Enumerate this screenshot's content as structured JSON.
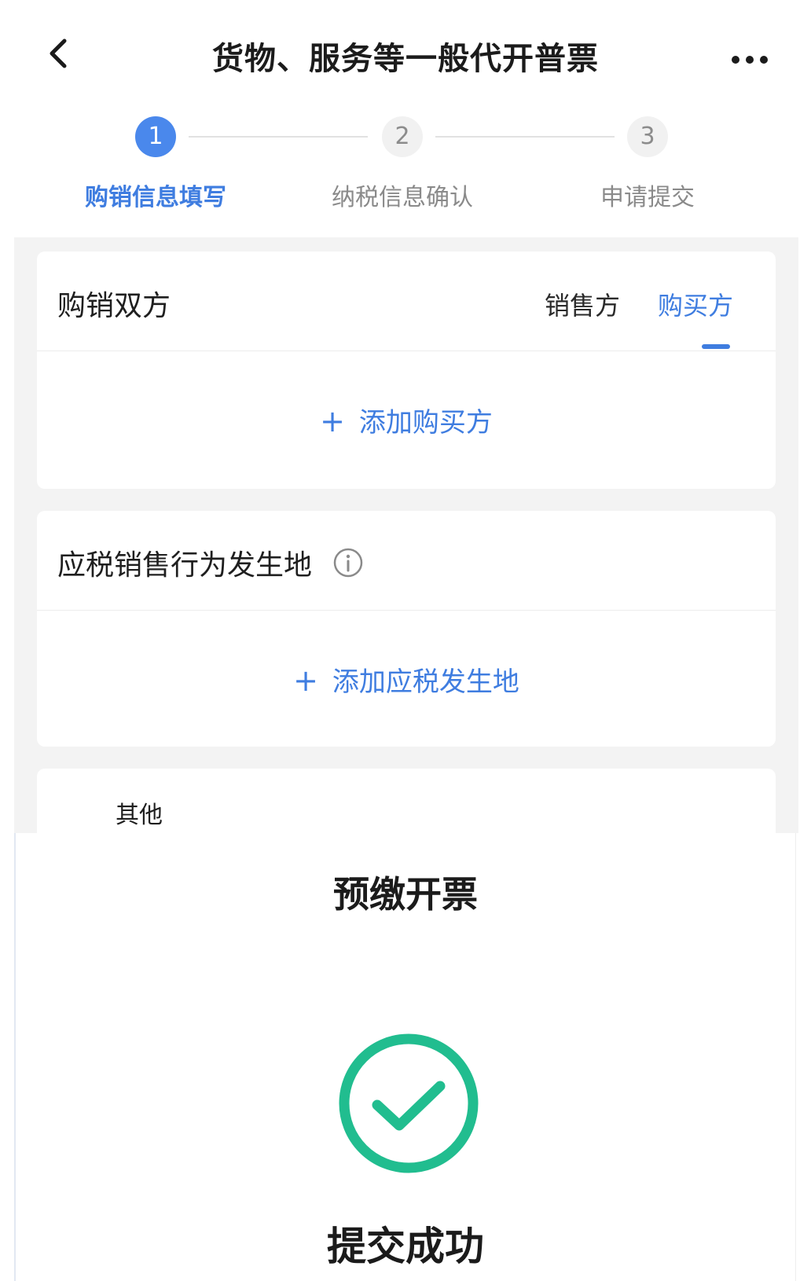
{
  "nav": {
    "back_icon": "chevron-left-icon",
    "title": "货物、服务等一般代开普票",
    "more_icon": "more-horizontal-icon"
  },
  "steps": [
    {
      "number": "1",
      "label": "购销信息填写",
      "state": "active"
    },
    {
      "number": "2",
      "label": "纳税信息确认",
      "state": "inactive"
    },
    {
      "number": "3",
      "label": "申请提交",
      "state": "inactive"
    }
  ],
  "parties_card": {
    "title": "购销双方",
    "tabs": [
      {
        "label": "销售方",
        "selected": false
      },
      {
        "label": "购买方",
        "selected": true
      }
    ],
    "add_label": "添加购买方"
  },
  "location_card": {
    "title": "应税销售行为发生地",
    "info_icon": "info-circle-icon",
    "add_label": "添加应税发生地"
  },
  "next_card": {
    "partial_title": "其他"
  },
  "prepay": {
    "title": "预缴开票",
    "status_icon": "check-circle-icon",
    "status_text": "提交成功"
  },
  "colors": {
    "accent": "#3f7de0",
    "step_active": "#4a88ec",
    "success": "#21bd8f",
    "background_gray": "#f3f3f3"
  }
}
